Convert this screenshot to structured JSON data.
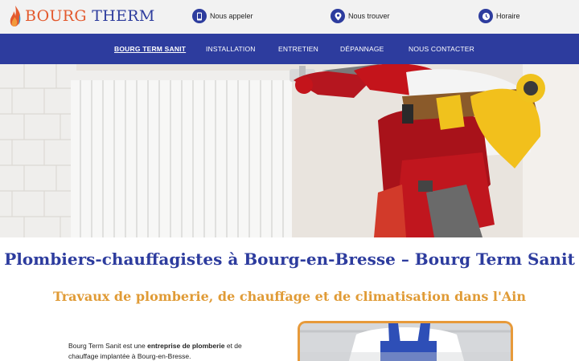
{
  "header": {
    "logo": {
      "word1": "BOURG",
      "word2": "THERM"
    },
    "contacts": [
      {
        "label": "Nous appeler",
        "icon": "phone-icon"
      },
      {
        "label": "Nous trouver",
        "icon": "location-pin-icon"
      },
      {
        "label": "Horaire",
        "icon": "clock-icon"
      }
    ]
  },
  "nav": {
    "items": [
      {
        "label": "BOURG TERM SANIT",
        "active": true
      },
      {
        "label": "INSTALLATION"
      },
      {
        "label": "ENTRETIEN"
      },
      {
        "label": "DÉPANNAGE"
      },
      {
        "label": "NOUS CONTACTER"
      }
    ]
  },
  "main": {
    "title": "Plombiers-chauffagistes à Bourg-en-Bresse – Bourg Term Sanit",
    "subtitle": "Travaux de plomberie, de chauffage et de climatisation dans l'Ain",
    "intro": {
      "before": "Bourg Term Sanit est une ",
      "bold": "entreprise de plomberie",
      "after": " et de chauffage implantée à Bourg-en-Bresse."
    }
  },
  "colors": {
    "brand_blue": "#2d3c9e",
    "brand_orange": "#e09b36",
    "logo_red": "#e3592d"
  }
}
